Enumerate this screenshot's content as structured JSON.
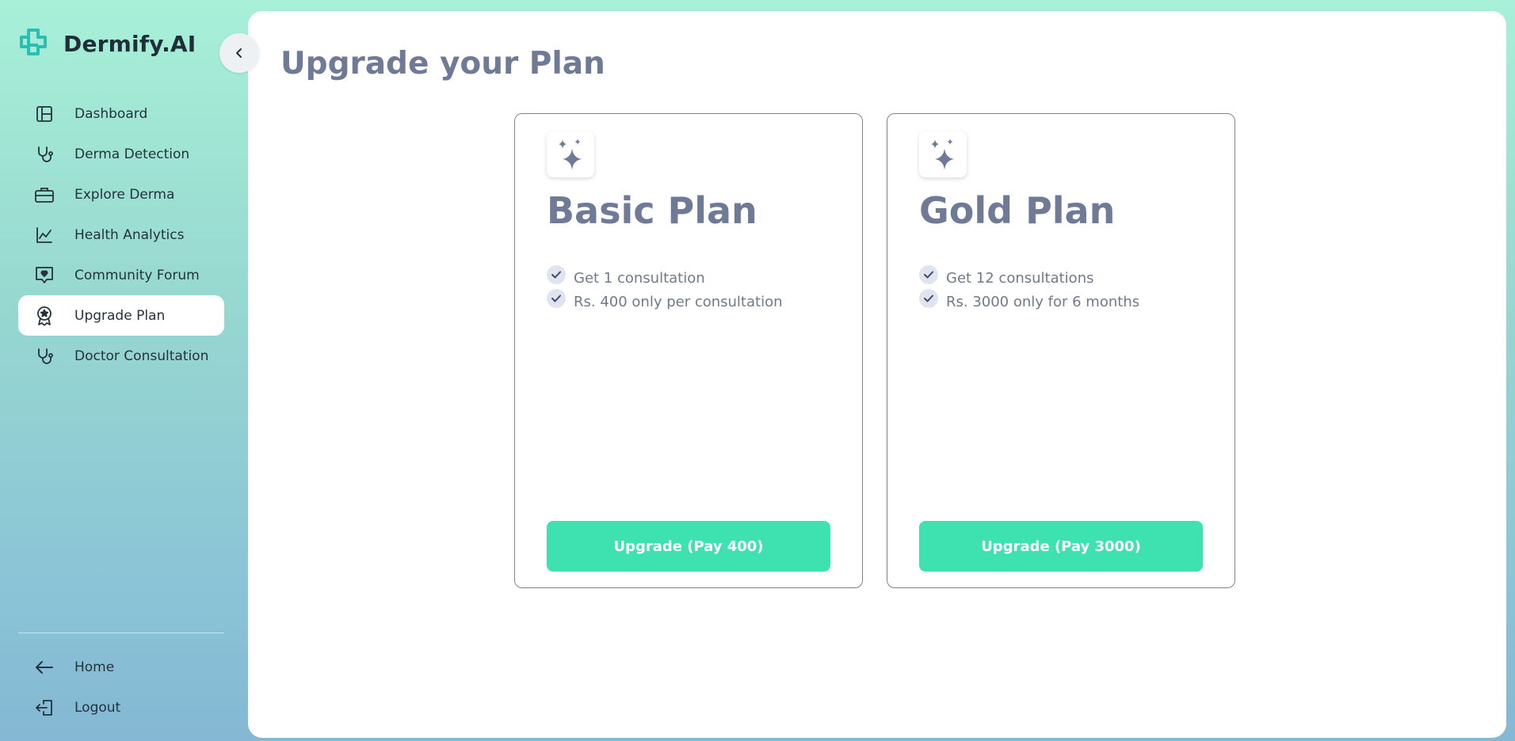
{
  "brand": {
    "name": "Dermify.AI"
  },
  "sidebar": {
    "items": [
      {
        "label": "Dashboard",
        "icon": "layout-icon",
        "active": false
      },
      {
        "label": "Derma Detection",
        "icon": "stethoscope-icon",
        "active": false
      },
      {
        "label": "Explore Derma",
        "icon": "briefcase-icon",
        "active": false
      },
      {
        "label": "Health Analytics",
        "icon": "line-chart-icon",
        "active": false
      },
      {
        "label": "Community Forum",
        "icon": "message-heart-icon",
        "active": false
      },
      {
        "label": "Upgrade Plan",
        "icon": "award-icon",
        "active": true
      },
      {
        "label": "Doctor Consultation",
        "icon": "stethoscope-icon",
        "active": false
      }
    ],
    "bottom_items": [
      {
        "label": "Home",
        "icon": "arrow-left-icon"
      },
      {
        "label": "Logout",
        "icon": "logout-icon"
      }
    ]
  },
  "main": {
    "title": "Upgrade your Plan",
    "plans": [
      {
        "title": "Basic Plan",
        "features": [
          "Get 1 consultation",
          "Rs. 400 only per consultation"
        ],
        "button_label": "Upgrade (Pay 400)"
      },
      {
        "title": "Gold Plan",
        "features": [
          "Get 12 consultations",
          "Rs. 3000 only for 6 months"
        ],
        "button_label": "Upgrade (Pay 3000)"
      }
    ]
  },
  "colors": {
    "accent": "#3de2b0",
    "brand_teal": "#2bbfb3",
    "title_text": "#6f7a96",
    "sidebar_gradient_top": "#a8f0d8",
    "sidebar_gradient_bottom": "#84b8d4"
  }
}
